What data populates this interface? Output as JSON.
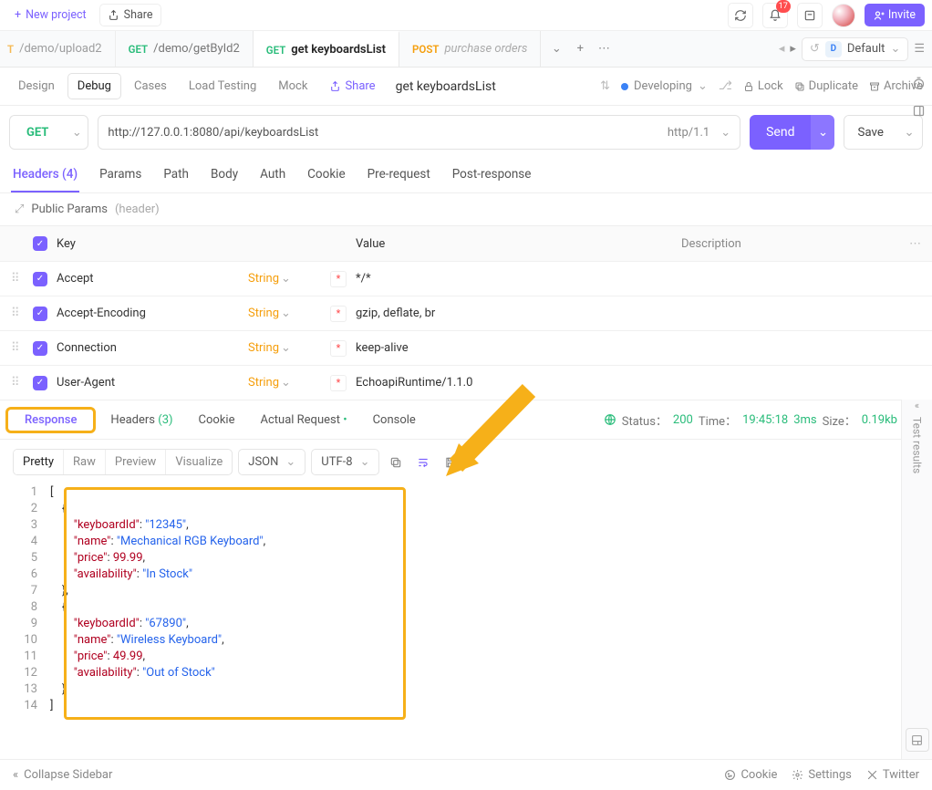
{
  "topbar": {
    "new_project": "New project",
    "share": "Share",
    "invite": "Invite",
    "notif_count": "17"
  },
  "tabs": [
    {
      "method": "GET",
      "method_cls": "method-get",
      "label": "/demo/upload2",
      "active": false,
      "split": true
    },
    {
      "method": "GET",
      "method_cls": "method-get",
      "label": "/demo/getById2",
      "active": false
    },
    {
      "method": "GET",
      "method_cls": "method-get",
      "label": "get keyboardsList",
      "active": true
    },
    {
      "method": "POST",
      "method_cls": "method-post",
      "label": "purchase orders",
      "active": false,
      "italic": true
    }
  ],
  "workspace": {
    "letter": "D",
    "name": "Default"
  },
  "subtabs": {
    "design": "Design",
    "debug": "Debug",
    "cases": "Cases",
    "load": "Load Testing",
    "mock": "Mock",
    "share": "Share"
  },
  "api_name": "get keyboardsList",
  "state": {
    "label": "Developing"
  },
  "actions": {
    "lock": "Lock",
    "dup": "Duplicate",
    "arch": "Archive"
  },
  "request": {
    "method": "GET",
    "url": "http://127.0.0.1:8080/api/keyboardsList",
    "proto": "http/1.1",
    "send": "Send",
    "save": "Save"
  },
  "req_tabs": {
    "headers": "Headers",
    "params": "Params",
    "path": "Path",
    "body": "Body",
    "auth": "Auth",
    "cookie": "Cookie",
    "prereq": "Pre-request",
    "postres": "Post-response",
    "hcount": "(4)"
  },
  "header_section": {
    "public": "Public Params",
    "header": "(header)",
    "key": "Key",
    "value": "Value",
    "desc": "Description",
    "type": "String"
  },
  "headers": [
    {
      "key": "Accept",
      "value": "*/*"
    },
    {
      "key": "Accept-Encoding",
      "value": "gzip, deflate, br"
    },
    {
      "key": "Connection",
      "value": "keep-alive"
    },
    {
      "key": "User-Agent",
      "value": "EchoapiRuntime/1.1.0"
    }
  ],
  "resp_tabs": {
    "response": "Response",
    "headers": "Headers",
    "hcount": "(3)",
    "cookie": "Cookie",
    "actual": "Actual Request",
    "console": "Console"
  },
  "resp_status": {
    "status_label": "Status：",
    "code": "200",
    "time_label": "Time：",
    "time": "19:45:18",
    "dur": "3ms",
    "size_label": "Size：",
    "size": "0.19kb"
  },
  "viewmodes": {
    "pretty": "Pretty",
    "raw": "Raw",
    "preview": "Preview",
    "visualize": "Visualize",
    "type": "JSON",
    "enc": "UTF-8"
  },
  "test_results": "Test results",
  "statusbar": {
    "collapse": "Collapse Sidebar",
    "cookie": "Cookie",
    "settings": "Settings",
    "twitter": "Twitter"
  },
  "response_body": [
    {
      "keyboardId": "12345",
      "name": "Mechanical RGB Keyboard",
      "price": 99.99,
      "availability": "In Stock"
    },
    {
      "keyboardId": "67890",
      "name": "Wireless Keyboard",
      "price": 49.99,
      "availability": "Out of Stock"
    }
  ],
  "code_lines": [
    {
      "n": 1,
      "html": "<span class='t-pun'>[</span>"
    },
    {
      "n": 2,
      "html": "    <span class='t-pun'>{</span>"
    },
    {
      "n": 3,
      "html": "        <span class='t-key'>\"keyboardId\"</span><span class='t-pun'>: </span><span class='t-str'>\"12345\"</span><span class='t-pun'>,</span>"
    },
    {
      "n": 4,
      "html": "        <span class='t-key'>\"name\"</span><span class='t-pun'>: </span><span class='t-str'>\"Mechanical RGB Keyboard\"</span><span class='t-pun'>,</span>"
    },
    {
      "n": 5,
      "html": "        <span class='t-key'>\"price\"</span><span class='t-pun'>: </span><span class='t-num'>99.99</span><span class='t-pun'>,</span>"
    },
    {
      "n": 6,
      "html": "        <span class='t-key'>\"availability\"</span><span class='t-pun'>: </span><span class='t-str'>\"In Stock\"</span>"
    },
    {
      "n": 7,
      "html": "    <span class='t-pun'>},</span>"
    },
    {
      "n": 8,
      "html": "    <span class='t-pun'>{</span>"
    },
    {
      "n": 9,
      "html": "        <span class='t-key'>\"keyboardId\"</span><span class='t-pun'>: </span><span class='t-str'>\"67890\"</span><span class='t-pun'>,</span>"
    },
    {
      "n": 10,
      "html": "        <span class='t-key'>\"name\"</span><span class='t-pun'>: </span><span class='t-str'>\"Wireless Keyboard\"</span><span class='t-pun'>,</span>"
    },
    {
      "n": 11,
      "html": "        <span class='t-key'>\"price\"</span><span class='t-pun'>: </span><span class='t-num'>49.99</span><span class='t-pun'>,</span>"
    },
    {
      "n": 12,
      "html": "        <span class='t-key'>\"availability\"</span><span class='t-pun'>: </span><span class='t-str'>\"Out of Stock\"</span>"
    },
    {
      "n": 13,
      "html": "    <span class='t-pun'>}</span>"
    },
    {
      "n": 14,
      "html": "<span class='t-pun'>]</span>"
    }
  ]
}
